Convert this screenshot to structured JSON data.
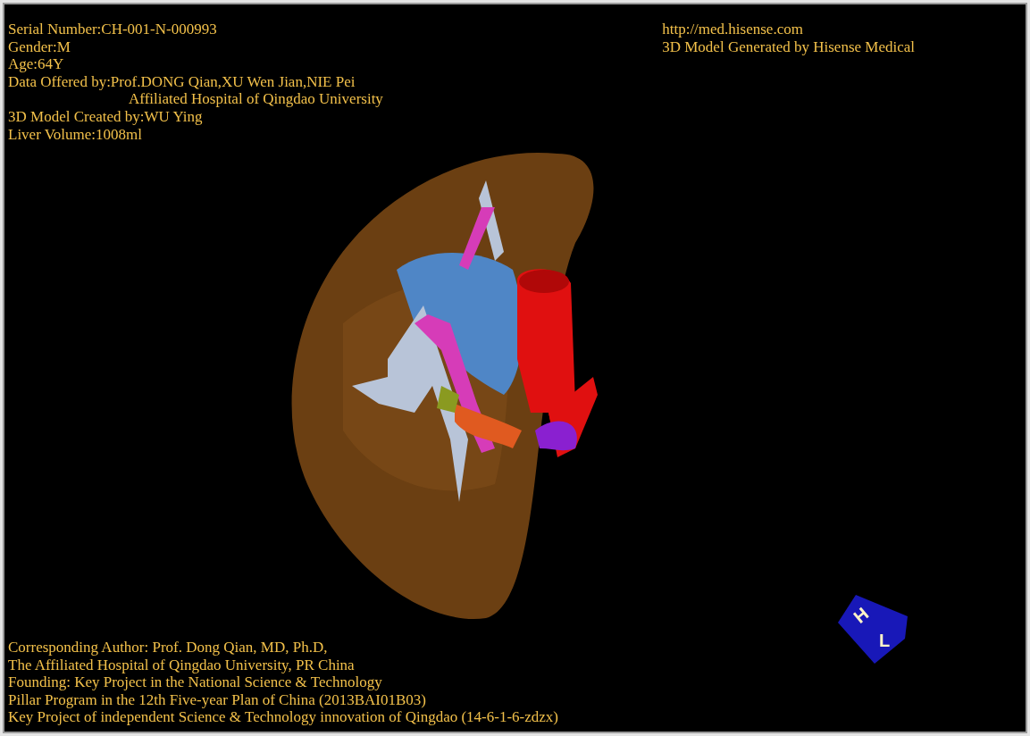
{
  "info_left": [
    {
      "kind": "line",
      "text": "Serial Number:CH-001-N-000993"
    },
    {
      "kind": "line",
      "text": "Gender:M"
    },
    {
      "kind": "line",
      "text": "Age:64Y"
    },
    {
      "kind": "line",
      "text": "Data Offered by:Prof.DONG Qian,XU Wen Jian,NIE Pei"
    },
    {
      "kind": "continuation",
      "text": "Affiliated Hospital of Qingdao University"
    },
    {
      "kind": "line",
      "text": "3D Model Created by:WU Ying"
    },
    {
      "kind": "line",
      "text": "Liver Volume:1008ml"
    }
  ],
  "info_right": [
    "http://med.hisense.com",
    "3D Model Generated by Hisense Medical"
  ],
  "credits": [
    "Corresponding Author: Prof. Dong Qian, MD, Ph.D,",
    "The Affiliated Hospital of Qingdao University, PR China",
    "Founding: Key Project in the National Science & Technology",
    "Pillar Program in the 12th Five-year Plan of China (2013BAI01B03)",
    "Key Project of independent Science & Technology innovation of Qingdao (14-6-1-6-zdzx)"
  ],
  "orientation_cube": {
    "faces": [
      "H",
      "L"
    ]
  }
}
